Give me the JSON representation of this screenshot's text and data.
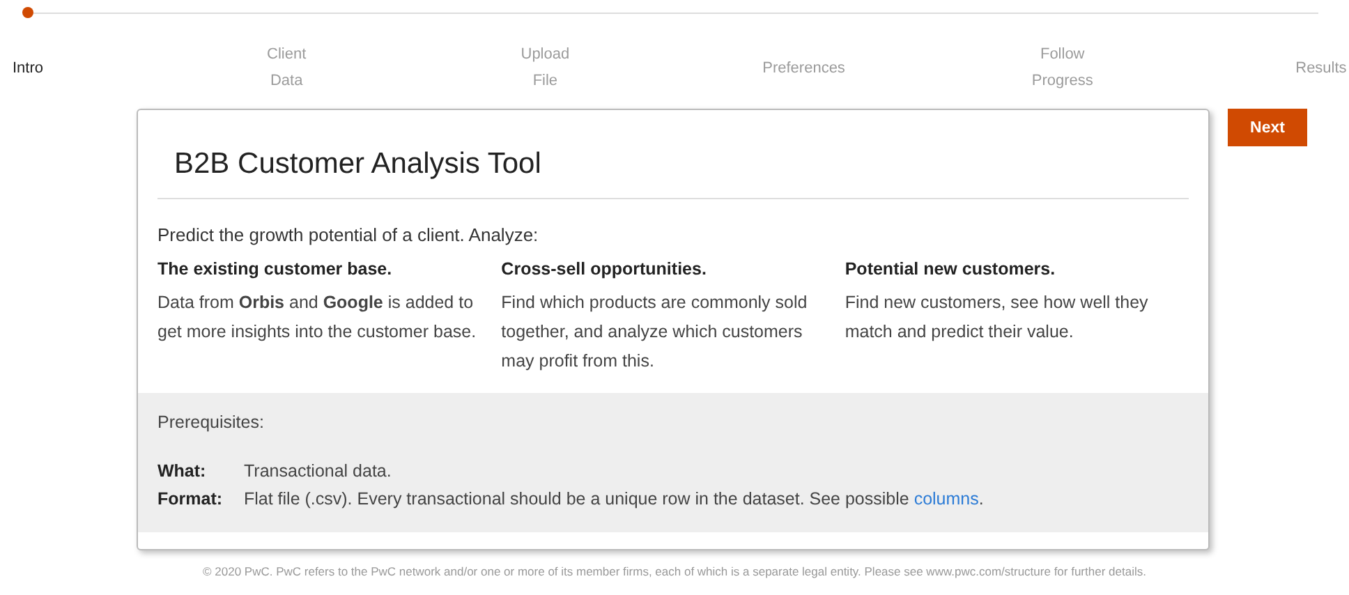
{
  "steps": [
    {
      "lines": [
        "Intro"
      ],
      "selected": true
    },
    {
      "lines": [
        "Client",
        "Data"
      ],
      "selected": false
    },
    {
      "lines": [
        "Upload",
        "File"
      ],
      "selected": false
    },
    {
      "lines": [
        "Preferences"
      ],
      "selected": false
    },
    {
      "lines": [
        "Follow",
        "Progress"
      ],
      "selected": false
    },
    {
      "lines": [
        "Results"
      ],
      "selected": false
    }
  ],
  "card": {
    "title": "B2B Customer Analysis Tool",
    "intro": "Predict the growth potential of a client. Analyze:",
    "features": [
      {
        "heading": "The existing customer base.",
        "text": "Data from **Orbis** and **Google** is added to get more insights into the customer base."
      },
      {
        "heading": "Cross-sell opportunities.",
        "text": "Find which products are commonly sold together, and analyze which customers may profit from this."
      },
      {
        "heading": "Potential new customers.",
        "text": "Find new customers, see how well they match and predict their value."
      }
    ],
    "prerequisites": {
      "title": "Prerequisites:",
      "rows": [
        {
          "label": "What:",
          "text": "Transactional data."
        },
        {
          "label": "Format:",
          "text": "Flat file (.csv). Every transactional should be a unique row in the dataset. See possible ",
          "link": "columns",
          "after": "."
        }
      ]
    }
  },
  "next_button": "Next",
  "footer": "© 2020 PwC. PwC refers to the PwC network and/or one or more of its member firms, each of which is a separate legal entity. Please see www.pwc.com/structure for further details."
}
